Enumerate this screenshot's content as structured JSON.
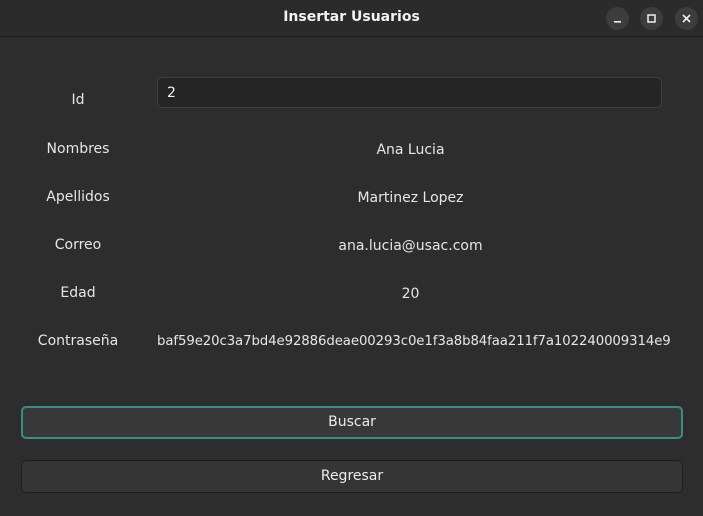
{
  "window": {
    "title": "Insertar Usuarios"
  },
  "form": {
    "id_label": "Id",
    "id_value": "2",
    "nombres_label": "Nombres",
    "nombres_value": "Ana Lucia",
    "apellidos_label": "Apellidos",
    "apellidos_value": "Martinez Lopez",
    "correo_label": "Correo",
    "correo_value": "ana.lucia@usac.com",
    "edad_label": "Edad",
    "edad_value": "20",
    "contrasena_label": "Contraseña",
    "contrasena_value": "baf59e20c3a7bd4e92886deae00293c0e1f3a8b84faa211f7a102240009314e9"
  },
  "buttons": {
    "buscar": "Buscar",
    "regresar": "Regresar"
  },
  "colors": {
    "focus_accent": "#3f8a83"
  }
}
